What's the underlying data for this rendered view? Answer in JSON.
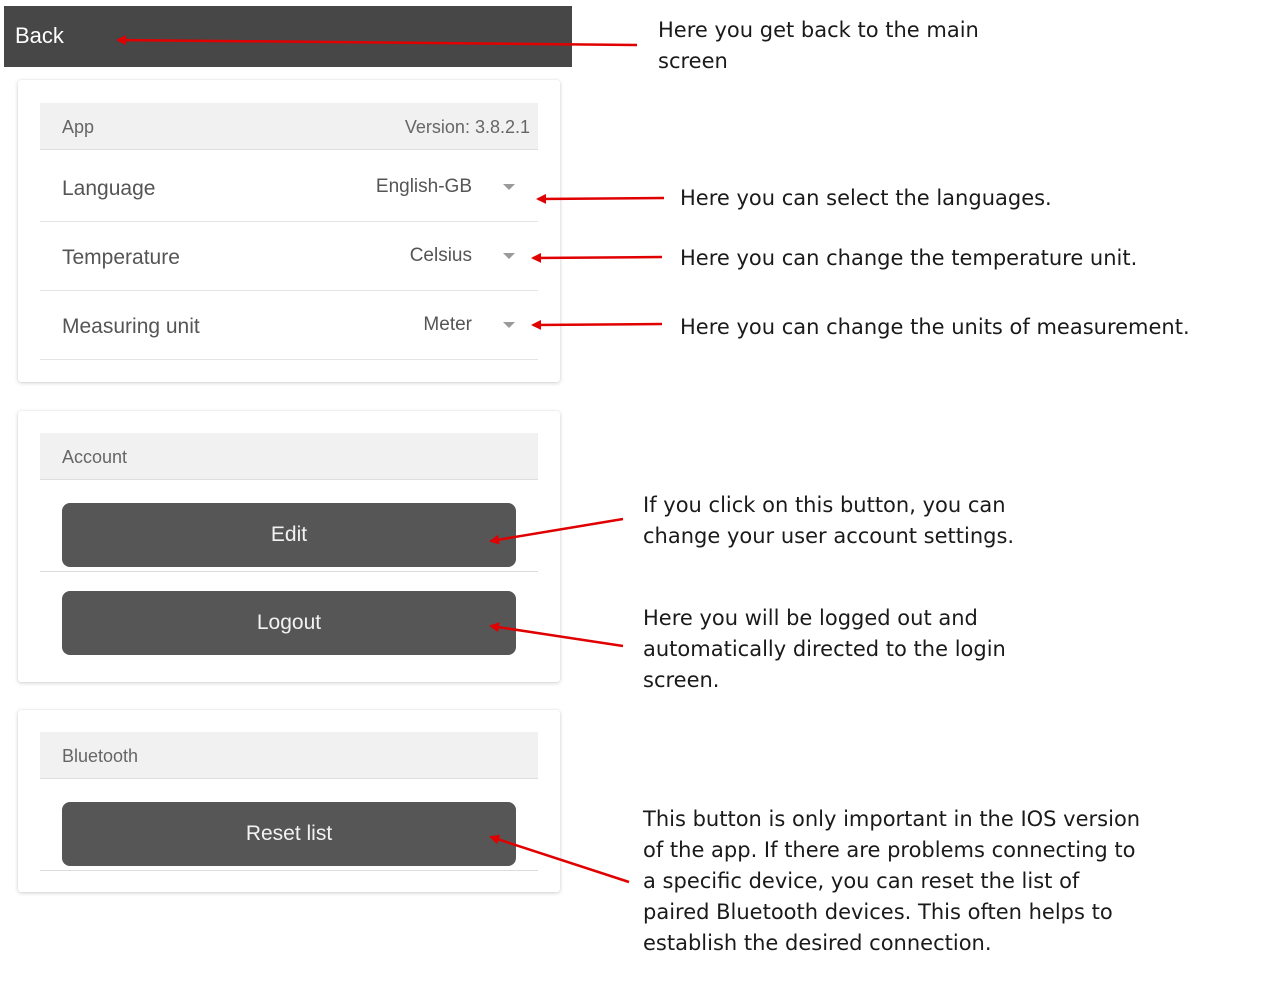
{
  "header": {
    "back_label": "Back"
  },
  "app_section": {
    "title": "App",
    "version": "Version: 3.8.2.1",
    "rows": [
      {
        "label": "Language",
        "value": "English-GB"
      },
      {
        "label": "Temperature",
        "value": "Celsius"
      },
      {
        "label": "Measuring unit",
        "value": "Meter"
      }
    ]
  },
  "account_section": {
    "title": "Account",
    "edit_label": "Edit",
    "logout_label": "Logout"
  },
  "bluetooth_section": {
    "title": "Bluetooth",
    "reset_label": "Reset list"
  },
  "annotations": {
    "back": "Here you get back to the main screen",
    "language": "Here you can select the languages.",
    "temperature": "Here you can change the temperature unit.",
    "measuring": "Here you can change the units of measurement.",
    "edit": "If you click on this button, you can change your user account settings.",
    "logout": "Here you will be logged out and automatically directed to the login screen.",
    "reset": "This button is only important in the IOS version of the app. If there are problems connecting to a specific device, you can reset the list of paired Bluetooth devices. This often helps to establish the desired connection."
  },
  "colors": {
    "topbar": "#474747",
    "button": "#565656",
    "arrow": "#e00000"
  }
}
